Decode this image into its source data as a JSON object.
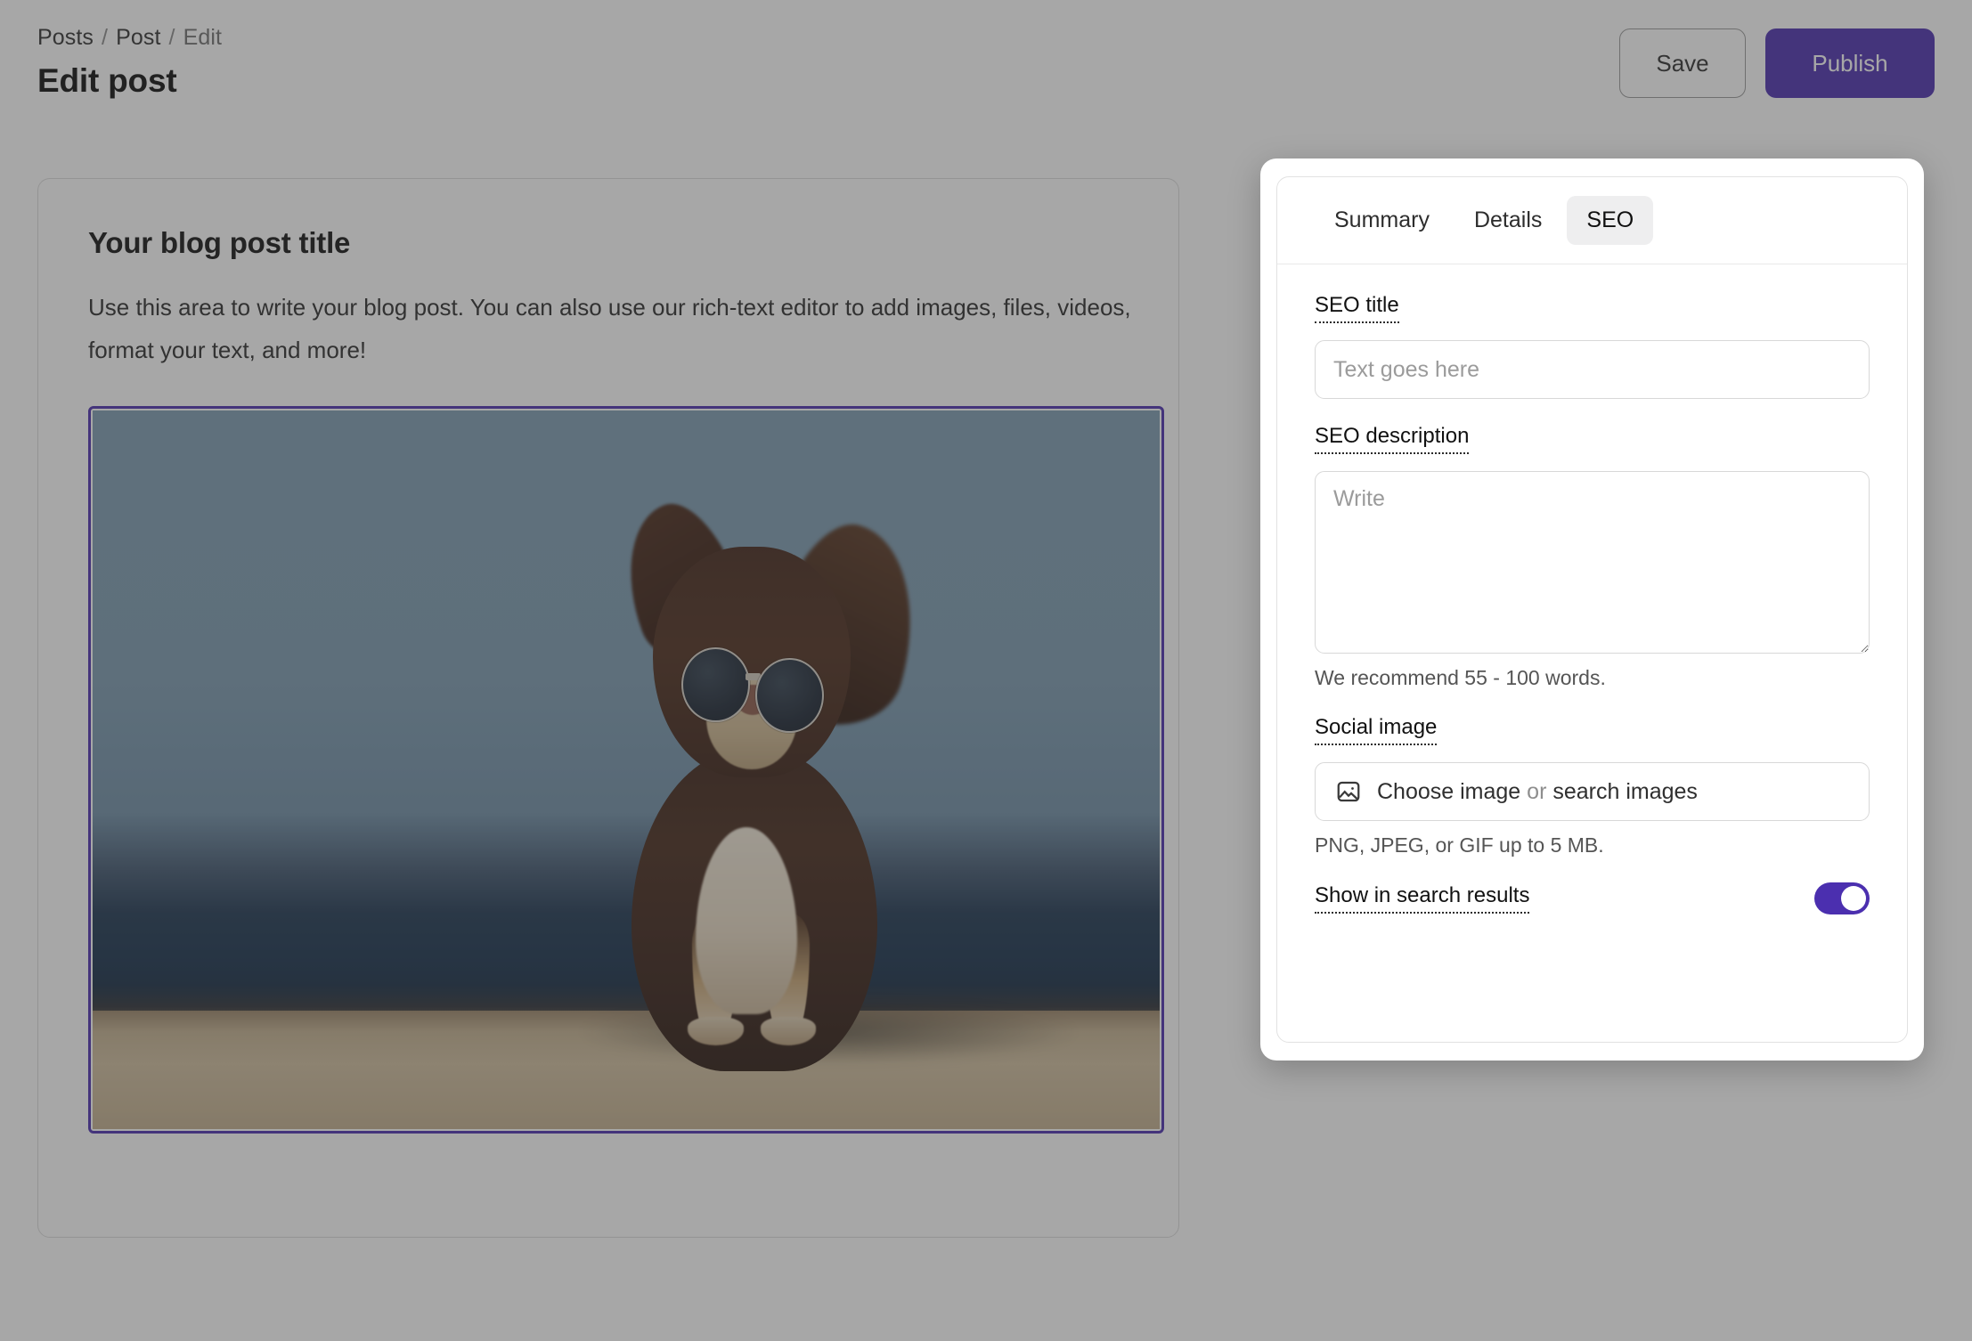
{
  "header": {
    "breadcrumb": [
      "Posts",
      "Post",
      "Edit"
    ],
    "breadcrumb_separator": "/",
    "title": "Edit post",
    "save_label": "Save",
    "publish_label": "Publish"
  },
  "editor": {
    "post_title": "Your blog post title",
    "post_body": "Use this area to write your blog post. You can also use our rich-text editor to add images, files, videos, format your text, and more!",
    "image_alt": "Chihuahua dog wearing round sunglasses sitting on a beach",
    "image_selected_color": "#4B2FAF"
  },
  "seo_panel": {
    "tabs": [
      {
        "label": "Summary",
        "active": false
      },
      {
        "label": "Details",
        "active": false
      },
      {
        "label": "SEO",
        "active": true
      }
    ],
    "seo_title": {
      "label": "SEO title",
      "value": "",
      "placeholder": "Text goes here"
    },
    "seo_description": {
      "label": "SEO description",
      "value": "",
      "placeholder": "Write",
      "hint": "We recommend 55 - 100 words."
    },
    "social_image": {
      "label": "Social image",
      "icon": "picture-icon",
      "choose_label": "Choose image",
      "or_label": "or",
      "search_label": "search images",
      "hint": "PNG, JPEG, or GIF up to 5 MB."
    },
    "show_in_search": {
      "label": "Show in search results",
      "enabled": true,
      "accent_color": "#4B2FAF"
    }
  }
}
